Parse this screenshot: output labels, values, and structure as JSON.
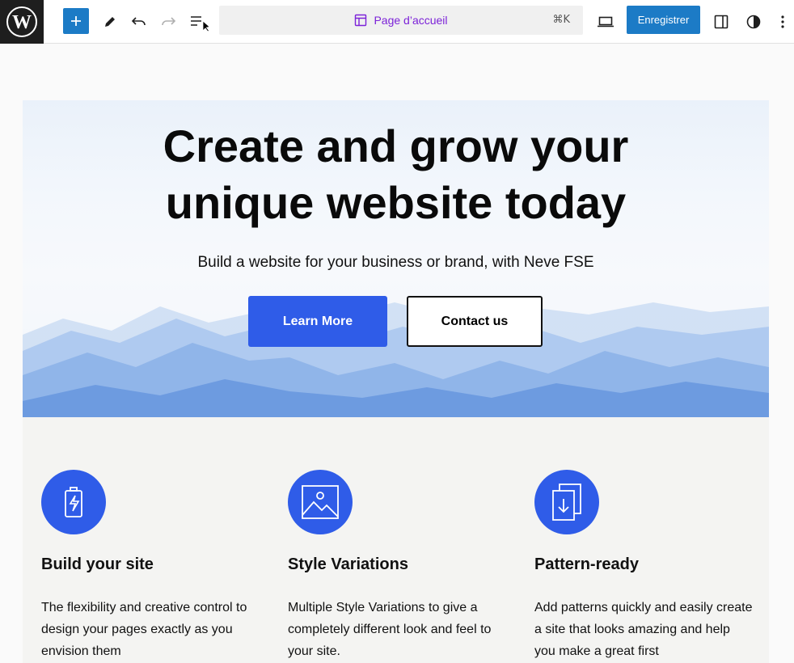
{
  "toolbar": {
    "page_title": "Page d’accueil",
    "shortcut": "⌘K",
    "save_label": "Enregistrer",
    "icons": [
      "wordpress-icon",
      "plus-icon",
      "pencil-icon",
      "undo-icon",
      "redo-icon",
      "list-view-icon",
      "layout-icon",
      "desktop-icon",
      "sidebar-icon",
      "contrast-icon",
      "more-vertical-icon"
    ],
    "accent": "#1c7bc6"
  },
  "hero": {
    "title_line1": "Create and grow your",
    "title_line2": "unique website today",
    "subtitle": "Build a website for your business or brand, with Neve FSE",
    "primary_button": "Learn More",
    "secondary_button": "Contact us",
    "button_color": "#2f5ce8"
  },
  "features": [
    {
      "icon": "battery-bolt-icon",
      "title": "Build your site",
      "description": "The flexibility and creative control to design your pages exactly as you envision them"
    },
    {
      "icon": "image-icon",
      "title": "Style Variations",
      "description": "Multiple Style Variations to give a completely different look and feel to your site."
    },
    {
      "icon": "documents-download-icon",
      "title": "Pattern-ready",
      "description": "Add patterns quickly and easily create a site that looks amazing and help you make a great first"
    }
  ]
}
